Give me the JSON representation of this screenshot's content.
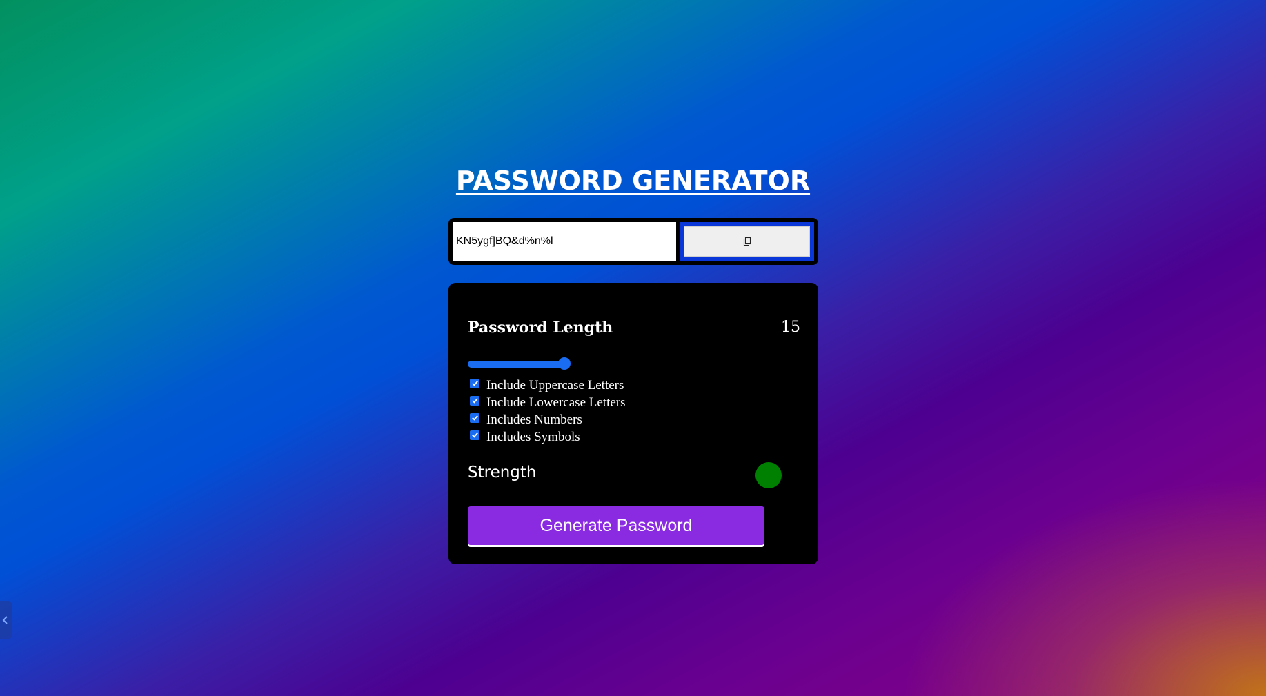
{
  "page": {
    "title": "PASSWORD GENERATOR"
  },
  "output": {
    "password": "KN5ygf]BQ&d%n%l",
    "copy_icon": "copy-icon"
  },
  "length": {
    "label": "Password Length",
    "value": "15",
    "slider_fraction": 0.9
  },
  "options": [
    {
      "label": "Include Uppercase Letters",
      "checked": true
    },
    {
      "label": "Include Lowercase Letters",
      "checked": true
    },
    {
      "label": "Includes Numbers",
      "checked": true
    },
    {
      "label": "Includes Symbols",
      "checked": true
    }
  ],
  "strength": {
    "label": "Strength",
    "indicator_color": "#008000"
  },
  "generate": {
    "label": "Generate Password",
    "color": "#8a2be2"
  },
  "side_tab": {
    "icon": "chevron-left-icon"
  }
}
